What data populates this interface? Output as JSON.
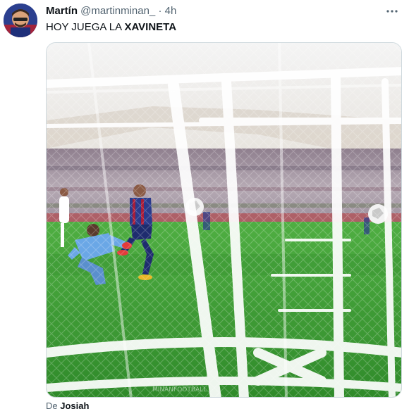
{
  "tweet": {
    "author": {
      "display_name": "Martín",
      "handle": "@martinminan_",
      "separator": "·",
      "time": "4h"
    },
    "text_plain": "HOY JUEGA LA ",
    "text_bold": "XAVINETA",
    "media": {
      "kind": "video-still",
      "watermark": "MINANFOOTBALL"
    },
    "source": {
      "prefix": "De ",
      "name": "Josiah"
    },
    "colors": {
      "pitch": "#3f9a35",
      "stands": "#a8a3b8",
      "net": "#ffffff",
      "keeper_kit": "#6aa7e6",
      "striker_kit": "#2a3a8c"
    },
    "icons": {
      "more": "more-horizontal-icon"
    }
  }
}
